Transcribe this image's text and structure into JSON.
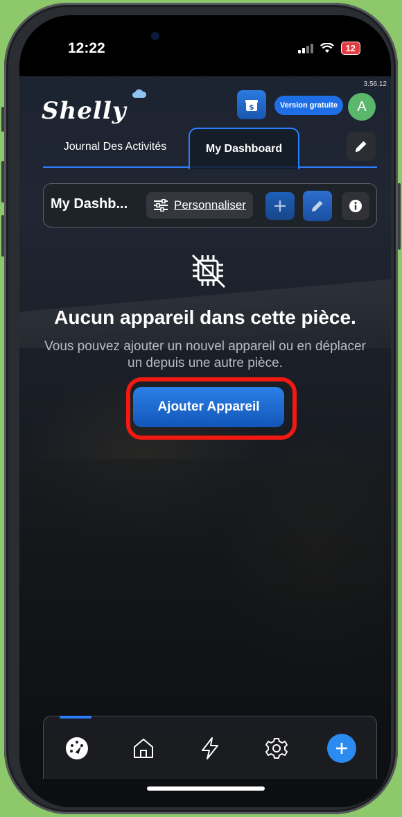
{
  "status_bar": {
    "time": "12:22",
    "battery": "12"
  },
  "app_version": "3.56.12",
  "header": {
    "logo": "Shelly",
    "plan_label": "Version gratuite",
    "avatar_initial": "A"
  },
  "tabs": [
    {
      "label": "Journal Des Activités",
      "active": false
    },
    {
      "label": "My Dashboard",
      "active": true
    }
  ],
  "toolbar": {
    "title": "My Dashb...",
    "customize_label": "Personnaliser"
  },
  "empty_state": {
    "title": "Aucun appareil dans cette pièce.",
    "subtitle": "Vous pouvez ajouter un nouvel appareil ou en déplacer un depuis une autre pièce.",
    "button_label": "Ajouter Appareil"
  },
  "bottom_nav": [
    {
      "icon": "dashboard-gauge-icon",
      "active": true
    },
    {
      "icon": "home-icon",
      "active": false
    },
    {
      "icon": "lightning-icon",
      "active": false
    },
    {
      "icon": "gear-icon",
      "active": false
    },
    {
      "icon": "plus-icon",
      "active": false
    }
  ],
  "colors": {
    "accent": "#2b7fff",
    "highlight_border": "#f21a10",
    "avatar": "#5ab76b"
  }
}
